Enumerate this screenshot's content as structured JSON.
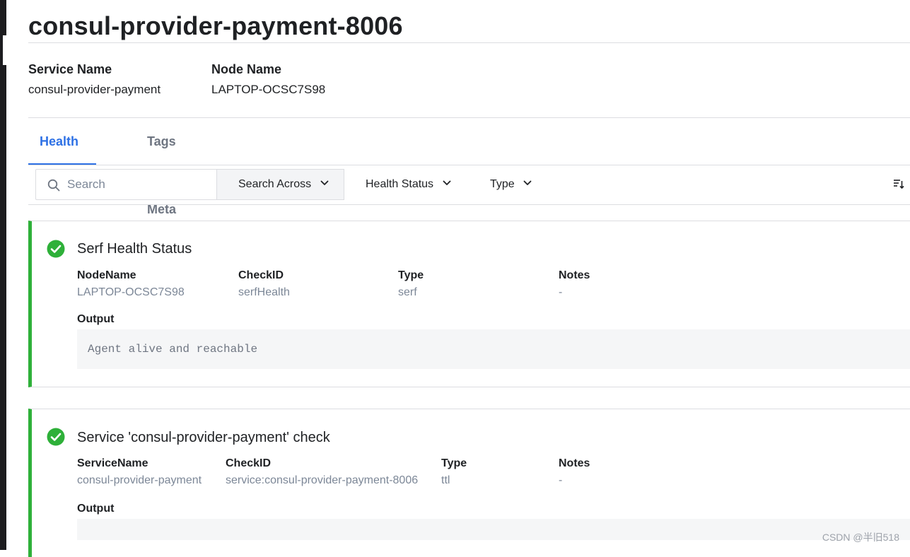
{
  "page": {
    "title": "consul-provider-payment-8006"
  },
  "meta": {
    "service_name_label": "Service Name",
    "service_name_value": "consul-provider-payment",
    "node_name_label": "Node Name",
    "node_name_value": "LAPTOP-OCSC7S98"
  },
  "tabs": [
    {
      "label": "Health Checks",
      "active": true
    },
    {
      "label": "Tags & Meta",
      "active": false
    }
  ],
  "toolbar": {
    "search_placeholder": "Search",
    "search_value": "",
    "search_across_label": "Search Across",
    "health_status_label": "Health Status",
    "type_label": "Type"
  },
  "checks": [
    {
      "title": "Serf Health Status",
      "status": "passing",
      "fields": [
        {
          "label": "NodeName",
          "value": "LAPTOP-OCSC7S98"
        },
        {
          "label": "CheckID",
          "value": "serfHealth"
        },
        {
          "label": "Type",
          "value": "serf"
        },
        {
          "label": "Notes",
          "value": "-"
        }
      ],
      "output_label": "Output",
      "output_text": "Agent alive and reachable"
    },
    {
      "title": "Service 'consul-provider-payment' check",
      "status": "passing",
      "fields": [
        {
          "label": "ServiceName",
          "value": "consul-provider-payment"
        },
        {
          "label": "CheckID",
          "value": "service:consul-provider-payment-8006"
        },
        {
          "label": "Type",
          "value": "ttl"
        },
        {
          "label": "Notes",
          "value": "-"
        }
      ],
      "output_label": "Output",
      "output_text": ""
    }
  ],
  "watermark": "CSDN @半旧518",
  "colors": {
    "accent": "#2e71e5",
    "passing": "#2eb039",
    "muted_text": "#7c8797",
    "border": "#dcdde1"
  }
}
